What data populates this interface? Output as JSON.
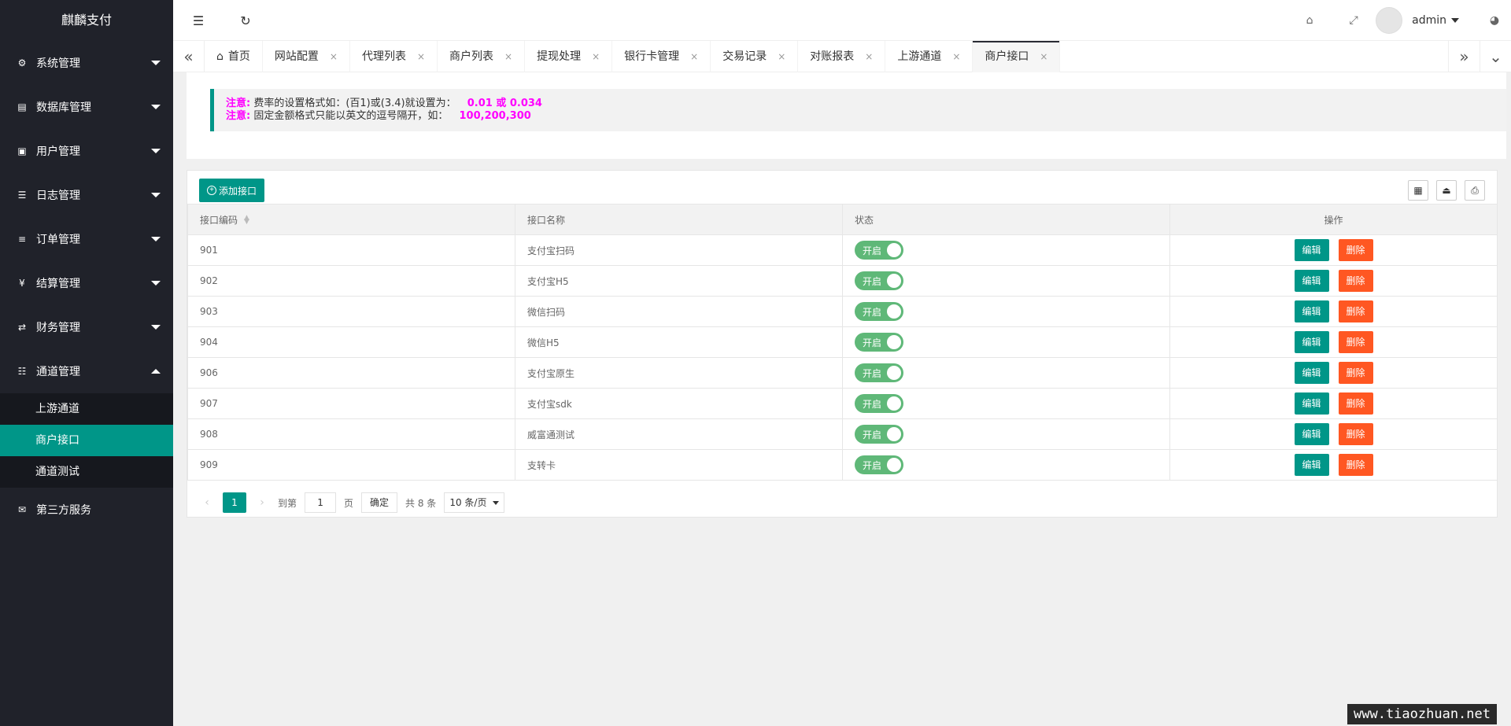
{
  "app": {
    "title": "麒麟支付"
  },
  "sidebar": {
    "items": [
      {
        "icon": "gear-icon",
        "glyph": "⚙",
        "label": "系统管理",
        "expanded": false
      },
      {
        "icon": "database-icon",
        "glyph": "▤",
        "label": "数据库管理",
        "expanded": false
      },
      {
        "icon": "users-icon",
        "glyph": "▣",
        "label": "用户管理",
        "expanded": false
      },
      {
        "icon": "log-icon",
        "glyph": "☰",
        "label": "日志管理",
        "expanded": false
      },
      {
        "icon": "list-icon",
        "glyph": "≡",
        "label": "订单管理",
        "expanded": false
      },
      {
        "icon": "yen-icon",
        "glyph": "¥",
        "label": "结算管理",
        "expanded": false
      },
      {
        "icon": "transfer-icon",
        "glyph": "⇄",
        "label": "财务管理",
        "expanded": false
      },
      {
        "icon": "channel-icon",
        "glyph": "☷",
        "label": "通道管理",
        "expanded": true
      }
    ],
    "subitems": [
      {
        "label": "上游通道",
        "active": false
      },
      {
        "label": "商户接口",
        "active": true
      },
      {
        "label": "通道测试",
        "active": false
      }
    ],
    "extra": {
      "icon": "mail-icon",
      "glyph": "✉",
      "label": "第三方服务"
    }
  },
  "header": {
    "menu_glyph": "☰",
    "refresh_glyph": "↻",
    "tag_glyph": "⌂",
    "fullscreen_glyph": "⤢",
    "theme_glyph": "◕",
    "username": "admin"
  },
  "tabs": {
    "left_arrow": "«",
    "right_arrow": "»",
    "down_arrow": "⌄",
    "home_glyph": "⌂",
    "items": [
      {
        "label": "首页",
        "closable": false,
        "active": false
      },
      {
        "label": "网站配置",
        "closable": true,
        "active": false
      },
      {
        "label": "代理列表",
        "closable": true,
        "active": false
      },
      {
        "label": "商户列表",
        "closable": true,
        "active": false
      },
      {
        "label": "提现处理",
        "closable": true,
        "active": false
      },
      {
        "label": "银行卡管理",
        "closable": true,
        "active": false
      },
      {
        "label": "交易记录",
        "closable": true,
        "active": false
      },
      {
        "label": "对账报表",
        "closable": true,
        "active": false
      },
      {
        "label": "上游通道",
        "closable": true,
        "active": false
      },
      {
        "label": "商户接口",
        "closable": true,
        "active": true
      }
    ],
    "close_glyph": "×"
  },
  "notice": {
    "line1": {
      "label": "注意:",
      "text": "费率的设置格式如：(百1)或(3.4)就设置为：",
      "value": "0.01 或 0.034"
    },
    "line2": {
      "label": "注意:",
      "text": "固定金额格式只能以英文的逗号隔开，如：",
      "value": "100,200,300"
    }
  },
  "toolbar": {
    "add_label": "添加接口",
    "add_glyph": "+",
    "tools": [
      {
        "name": "columns-icon",
        "glyph": "▦"
      },
      {
        "name": "export-icon",
        "glyph": "⏏"
      },
      {
        "name": "print-icon",
        "glyph": "⎙"
      }
    ]
  },
  "table": {
    "columns": [
      "接口编码",
      "接口名称",
      "状态",
      "操作"
    ],
    "rows": [
      {
        "code": "901",
        "name": "支付宝扫码",
        "status": "开启"
      },
      {
        "code": "902",
        "name": "支付宝H5",
        "status": "开启"
      },
      {
        "code": "903",
        "name": "微信扫码",
        "status": "开启"
      },
      {
        "code": "904",
        "name": "微信H5",
        "status": "开启"
      },
      {
        "code": "906",
        "name": "支付宝原生",
        "status": "开启"
      },
      {
        "code": "907",
        "name": "支付宝sdk",
        "status": "开启"
      },
      {
        "code": "908",
        "name": "威富通测试",
        "status": "开启"
      },
      {
        "code": "909",
        "name": "支转卡",
        "status": "开启"
      }
    ],
    "edit_label": "编辑",
    "delete_label": "删除"
  },
  "pager": {
    "prev": "‹",
    "next": "›",
    "current": "1",
    "goto_label": "到第",
    "goto_value": "1",
    "page_suffix": "页",
    "confirm": "确定",
    "total": "共 8 条",
    "page_size": "10 条/页"
  },
  "watermark": "www.tiaozhuan.net",
  "colors": {
    "accent": "#009688",
    "danger": "#ff5722",
    "switch_on": "#5fb878",
    "sidebar_bg": "#20222a"
  }
}
